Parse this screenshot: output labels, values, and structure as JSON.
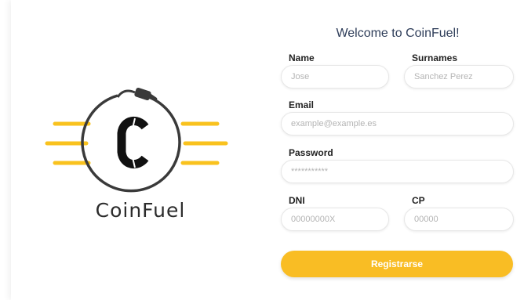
{
  "brand": {
    "name": "CoinFuel"
  },
  "form": {
    "title": "Welcome to CoinFuel!",
    "name_label": "Name",
    "name_placeholder": "Jose",
    "surnames_label": "Surnames",
    "surnames_placeholder": "Sanchez Perez",
    "email_label": "Email",
    "email_placeholder": "example@example.es",
    "password_label": "Password",
    "password_placeholder": "***********",
    "dni_label": "DNI",
    "dni_placeholder": "00000000X",
    "cp_label": "CP",
    "cp_placeholder": "00000",
    "submit_label": "Registrarse"
  },
  "colors": {
    "accent": "#f9bd24",
    "ring": "#3a3a3a",
    "text": "#222222"
  },
  "icons": {
    "logo": "fuel-nozzle-coin-logo-icon"
  }
}
